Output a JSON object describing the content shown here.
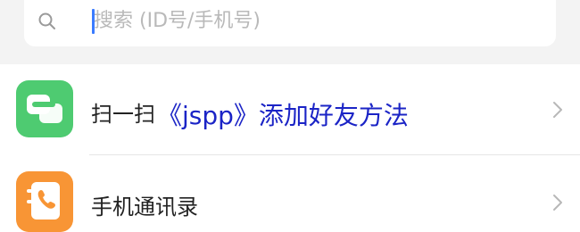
{
  "search": {
    "placeholder": "搜索 (ID号/手机号)"
  },
  "menu": {
    "items": [
      {
        "label": "扫一扫",
        "icon": "scan-icon",
        "color": "#4ecb71"
      },
      {
        "label": "手机通讯录",
        "icon": "phone-contacts-icon",
        "color": "#f89535"
      }
    ]
  },
  "overlay": {
    "title": "《jspp》添加好友方法"
  },
  "colors": {
    "accent": "#3a7bff",
    "overlay_text": "#1b24c6"
  }
}
